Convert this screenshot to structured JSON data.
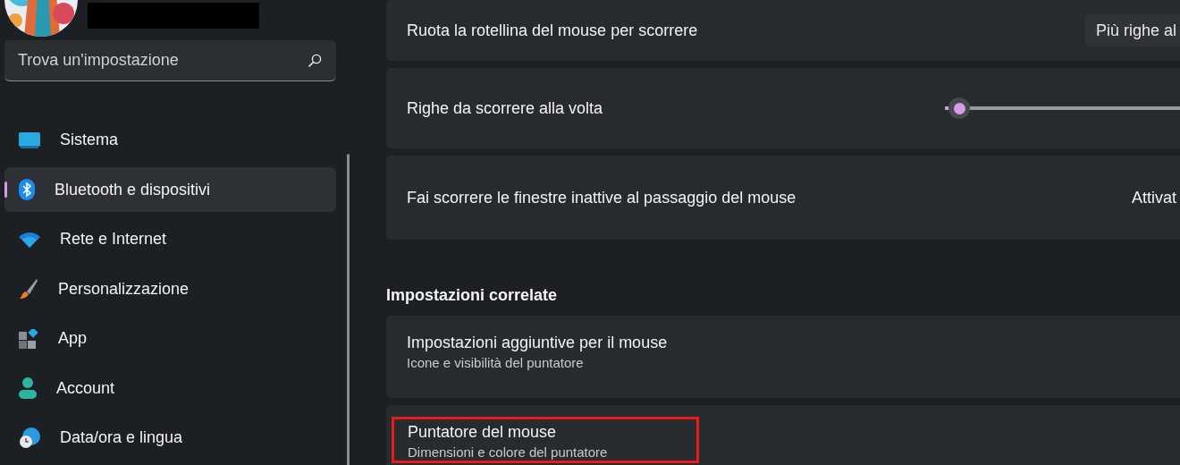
{
  "profile": {
    "name_redacted": true
  },
  "search": {
    "placeholder": "Trova un'impostazione"
  },
  "sidebar": {
    "items": [
      {
        "label": "Sistema",
        "selected": false
      },
      {
        "label": "Bluetooth e dispositivi",
        "selected": true
      },
      {
        "label": "Rete e Internet",
        "selected": false
      },
      {
        "label": "Personalizzazione",
        "selected": false
      },
      {
        "label": "App",
        "selected": false
      },
      {
        "label": "Account",
        "selected": false
      },
      {
        "label": "Data/ora e lingua",
        "selected": false
      }
    ]
  },
  "settings": [
    {
      "kind": "dropdown",
      "label": "Ruota la rotellina del mouse per scorrere",
      "value": "Più righe al"
    },
    {
      "kind": "slider",
      "label": "Righe da scorrere alla volta",
      "level": 0.02
    },
    {
      "kind": "toggle",
      "label": "Fai scorrere le finestre inattive al passaggio del mouse",
      "state_text": "Attivat"
    }
  ],
  "related": {
    "heading": "Impostazioni correlate",
    "items": [
      {
        "title": "Impostazioni aggiuntive per il mouse",
        "subtitle": "Icone e visibilità del puntatore",
        "highlighted": false
      },
      {
        "title": "Puntatore del mouse",
        "subtitle": "Dimensioni e colore del puntatore",
        "highlighted": true
      }
    ]
  }
}
